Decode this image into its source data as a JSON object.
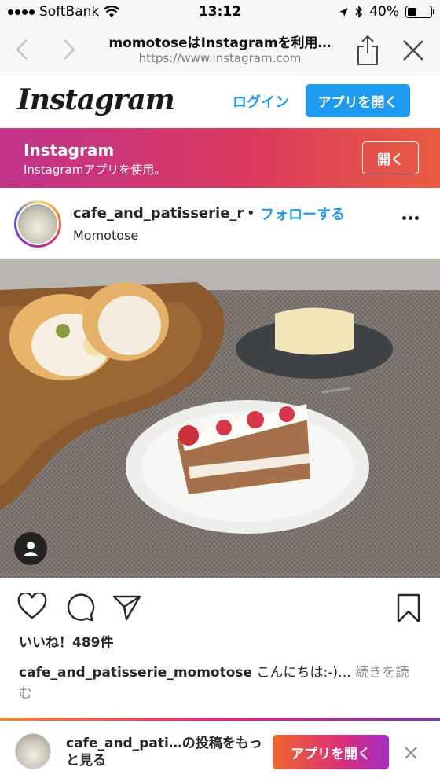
{
  "status_bar": {
    "carrier": "SoftBank",
    "time": "13:12",
    "battery": "40%",
    "battery_level": 0.4
  },
  "browser": {
    "page_title": "momotoseはInstagramを利用…",
    "url": "https://www.instagram.com"
  },
  "header": {
    "logo": "Instagram",
    "login": "ログイン",
    "open_app": "アプリを開く"
  },
  "banner": {
    "title": "Instagram",
    "subtitle": "Instagramアプリを使用。",
    "button": "開く"
  },
  "post": {
    "username": "cafe_and_patisserie_r",
    "separator": "•",
    "follow": "フォローする",
    "location": "Momotose"
  },
  "engagement": {
    "likes": "いいね！489件",
    "caption_user": "cafe_and_patisserie_momotose",
    "caption_text": " こんにちは:-)…",
    "more": " 続きを読む"
  },
  "footer": {
    "text": "cafe_and_pati…の投稿をもっと見る",
    "open_app": "アプリを開く"
  },
  "icons": {
    "heart": "heart-icon",
    "comment": "comment-icon",
    "share": "send-icon",
    "bookmark": "bookmark-icon"
  }
}
